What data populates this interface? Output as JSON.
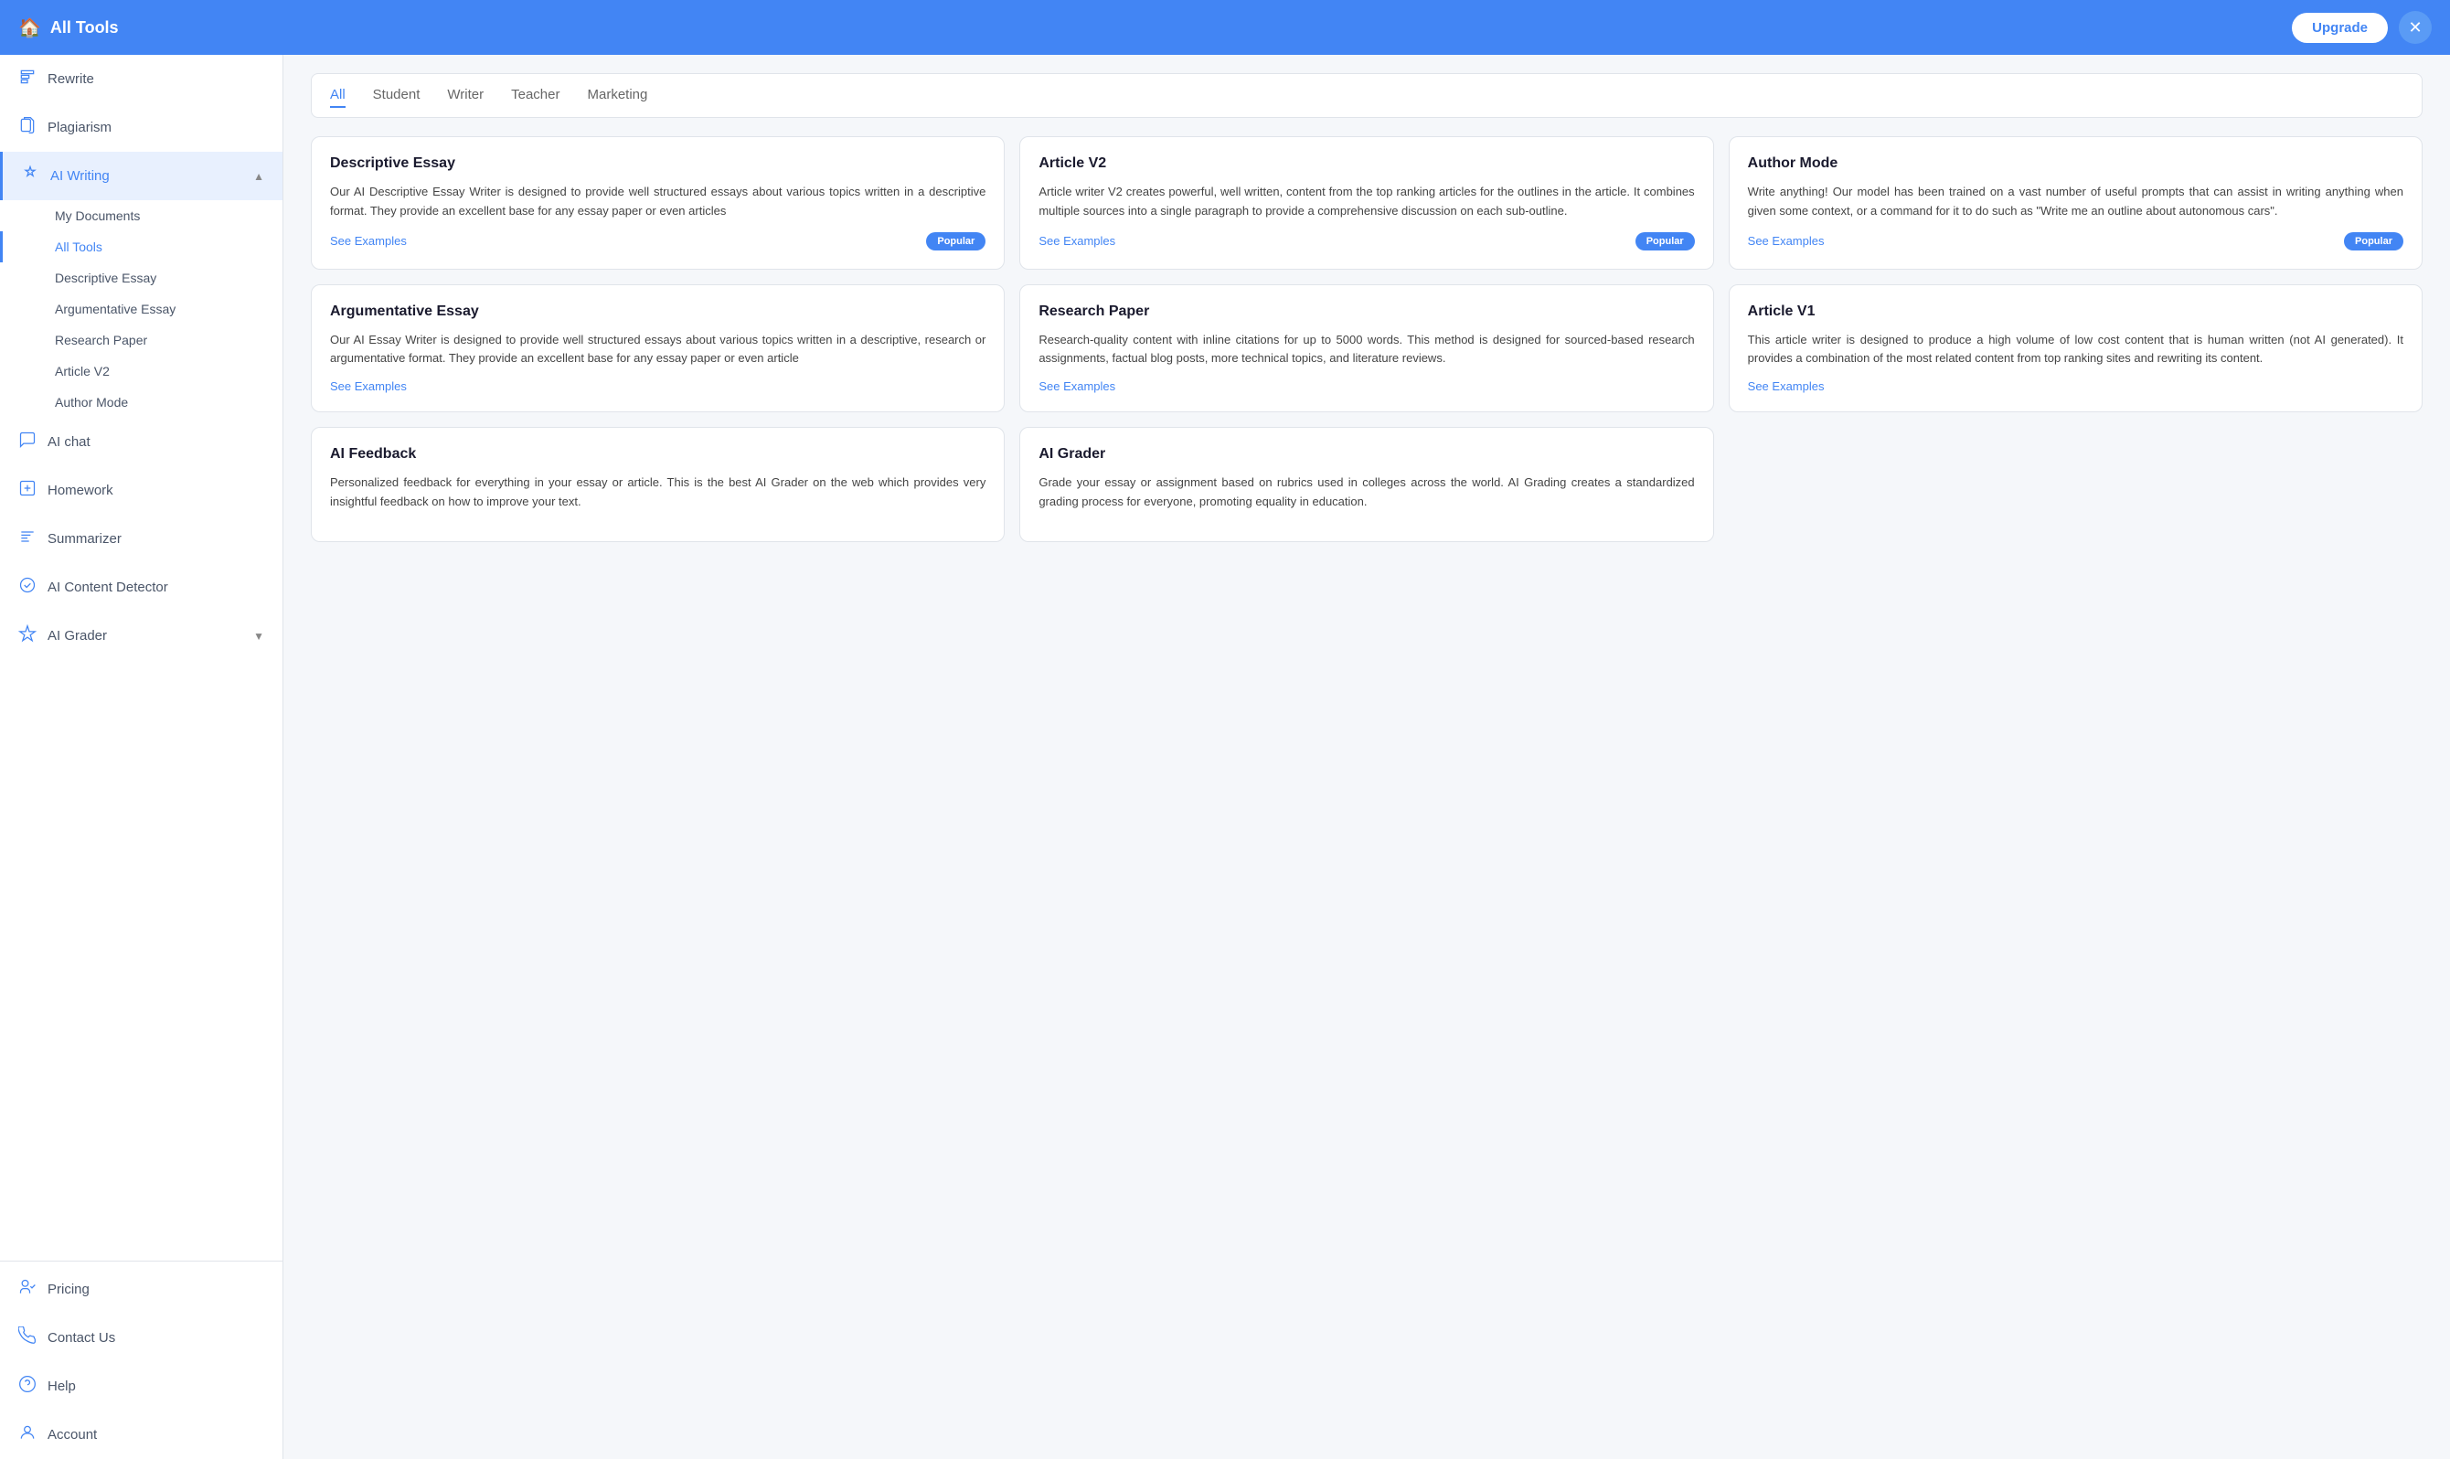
{
  "header": {
    "title": "All Tools",
    "upgrade_label": "Upgrade",
    "close_icon": "✕"
  },
  "sidebar": {
    "items": [
      {
        "id": "rewrite",
        "label": "Rewrite",
        "icon": "rewrite"
      },
      {
        "id": "plagiarism",
        "label": "Plagiarism",
        "icon": "plagiarism"
      },
      {
        "id": "ai-writing",
        "label": "AI Writing",
        "icon": "pen",
        "active": true,
        "expanded": true,
        "subitems": [
          {
            "id": "my-documents",
            "label": "My Documents"
          },
          {
            "id": "all-tools",
            "label": "All Tools",
            "active": true
          },
          {
            "id": "descriptive-essay",
            "label": "Descriptive Essay"
          },
          {
            "id": "argumentative-essay",
            "label": "Argumentative Essay"
          },
          {
            "id": "research-paper",
            "label": "Research Paper"
          },
          {
            "id": "article-v2",
            "label": "Article V2"
          },
          {
            "id": "author-mode",
            "label": "Author Mode"
          }
        ]
      },
      {
        "id": "ai-chat",
        "label": "AI chat",
        "icon": "chat"
      },
      {
        "id": "homework",
        "label": "Homework",
        "icon": "homework"
      },
      {
        "id": "summarizer",
        "label": "Summarizer",
        "icon": "summarizer"
      },
      {
        "id": "ai-content-detector",
        "label": "AI Content Detector",
        "icon": "detector"
      },
      {
        "id": "ai-grader",
        "label": "AI Grader",
        "icon": "grader",
        "hasChevron": true
      }
    ],
    "bottom_items": [
      {
        "id": "pricing",
        "label": "Pricing",
        "icon": "pricing"
      },
      {
        "id": "contact-us",
        "label": "Contact Us",
        "icon": "contact"
      },
      {
        "id": "help",
        "label": "Help",
        "icon": "help"
      },
      {
        "id": "account",
        "label": "Account",
        "icon": "account"
      }
    ]
  },
  "filter_tabs": [
    {
      "id": "all",
      "label": "All",
      "active": true
    },
    {
      "id": "student",
      "label": "Student"
    },
    {
      "id": "writer",
      "label": "Writer"
    },
    {
      "id": "teacher",
      "label": "Teacher"
    },
    {
      "id": "marketing",
      "label": "Marketing"
    }
  ],
  "cards": [
    {
      "id": "descriptive-essay",
      "title": "Descriptive Essay",
      "desc": "Our AI Descriptive Essay Writer is designed to provide well structured essays about various topics written in a descriptive format. They provide an excellent base for any essay paper or even articles",
      "see_examples": "See Examples",
      "popular": true
    },
    {
      "id": "article-v2",
      "title": "Article V2",
      "desc": "Article writer V2 creates powerful, well written, content from the top ranking articles for the outlines in the article. It combines multiple sources into a single paragraph to provide a comprehensive discussion on each sub-outline.",
      "see_examples": "See Examples",
      "popular": true
    },
    {
      "id": "author-mode",
      "title": "Author Mode",
      "desc": "Write anything! Our model has been trained on a vast number of useful prompts that can assist in writing anything when given some context, or a command for it to do such as \"Write me an outline about autonomous cars\".",
      "see_examples": "See Examples",
      "popular": true
    },
    {
      "id": "argumentative-essay",
      "title": "Argumentative Essay",
      "desc": "Our AI Essay Writer is designed to provide well structured essays about various topics written in a descriptive, research or argumentative format. They provide an excellent base for any essay paper or even article",
      "see_examples": "See Examples",
      "popular": false
    },
    {
      "id": "research-paper",
      "title": "Research Paper",
      "desc": "Research-quality content with inline citations for up to 5000 words. This method is designed for sourced-based research assignments, factual blog posts, more technical topics, and literature reviews.",
      "see_examples": "See Examples",
      "popular": false
    },
    {
      "id": "article-v1",
      "title": "Article V1",
      "desc": "This article writer is designed to produce a high volume of low cost content that is human written (not AI generated). It provides a combination of the most related content from top ranking sites and rewriting its content.",
      "see_examples": "See Examples",
      "popular": false
    },
    {
      "id": "ai-feedback",
      "title": "AI Feedback",
      "desc": "Personalized feedback for everything in your essay or article. This is the best AI Grader on the web which provides very insightful feedback on how to improve your text.",
      "see_examples": null,
      "popular": false
    },
    {
      "id": "ai-grader",
      "title": "AI Grader",
      "desc": "Grade your essay or assignment based on rubrics used in colleges across the world. AI Grading creates a standardized grading process for everyone, promoting equality in education.",
      "see_examples": null,
      "popular": false
    }
  ],
  "popular_label": "Popular"
}
